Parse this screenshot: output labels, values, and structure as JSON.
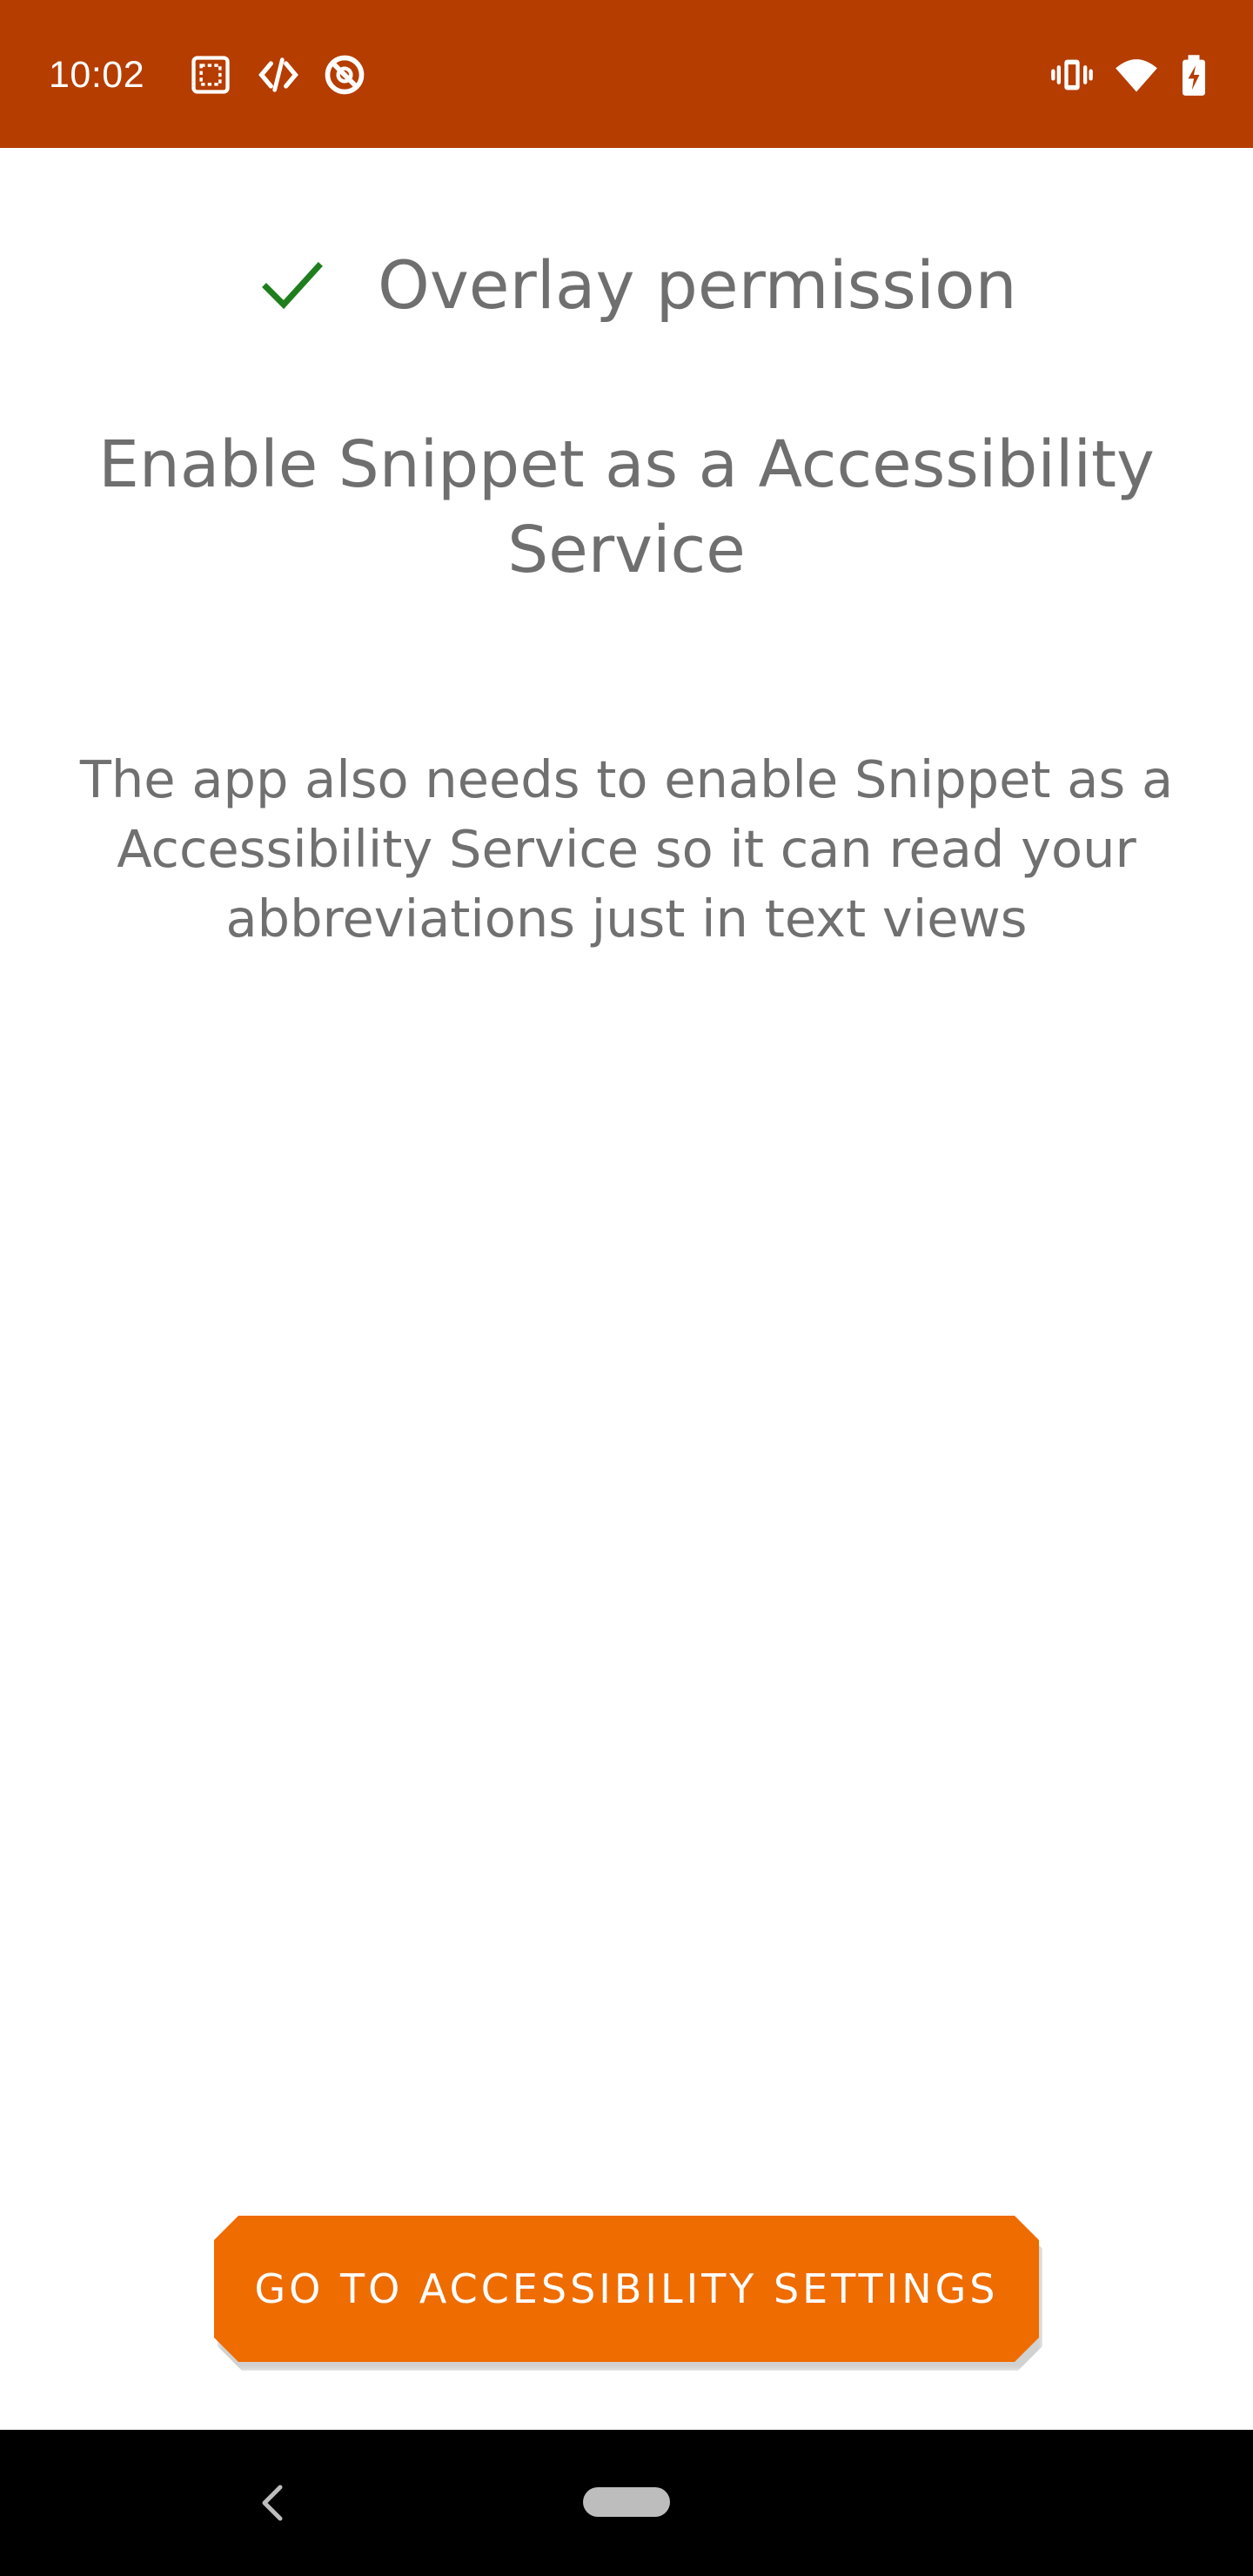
{
  "status_bar": {
    "time": "10:02",
    "background_color": "#b53d00",
    "left_icons": [
      "screenshot-icon",
      "code-icon",
      "no-disturb-icon"
    ],
    "right_icons": [
      "vibrate-icon",
      "wifi-icon",
      "battery-charging-icon"
    ]
  },
  "permission": {
    "check_icon": "checkmark-icon",
    "check_color": "#1e7e1e",
    "label": "Overlay permission"
  },
  "heading": "Enable Snippet as a Accessibility Service",
  "description": "The app also needs to enable Snippet as a Accessibility Service so it can read your abbreviations just in text views",
  "action_button": {
    "label": "Go to Accessibility Settings",
    "color": "#ef6c00"
  },
  "nav_bar": {
    "back_icon": "back-chevron-icon",
    "home_icon": "home-pill-icon"
  }
}
